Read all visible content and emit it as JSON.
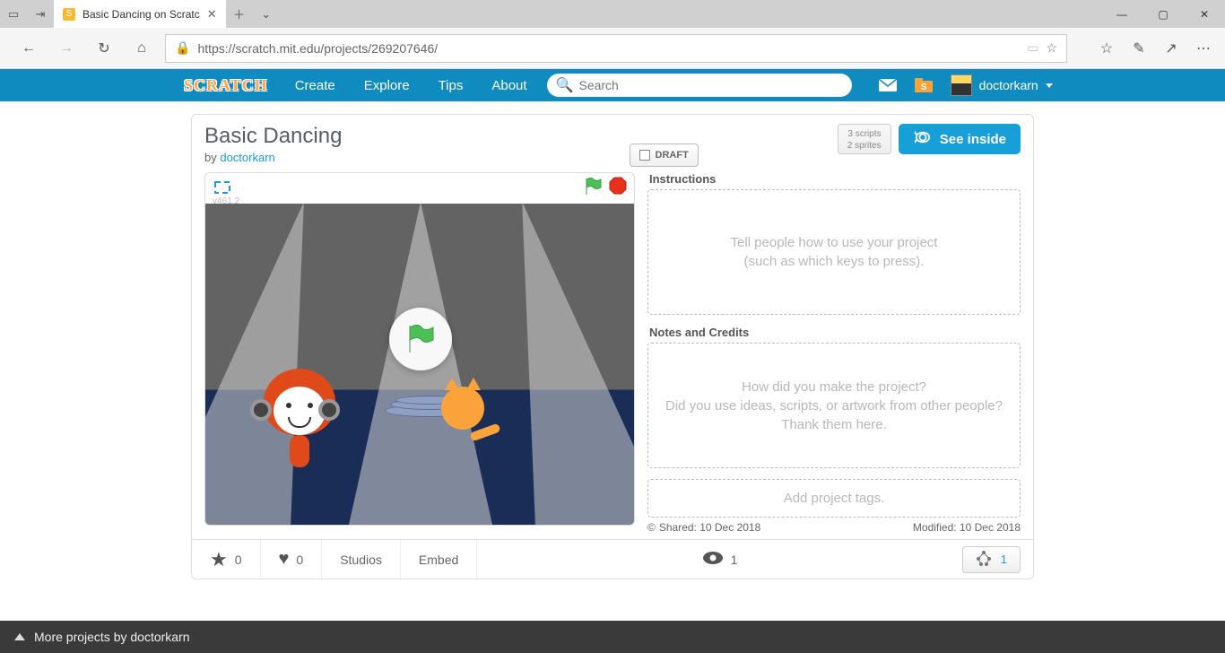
{
  "browser": {
    "tab_title": "Basic Dancing on Scratc",
    "url": "https://scratch.mit.edu/projects/269207646/"
  },
  "nav": {
    "logo": "SCRATCH",
    "links": {
      "create": "Create",
      "explore": "Explore",
      "tips": "Tips",
      "about": "About"
    },
    "search_placeholder": "Search",
    "username": "doctorkarn"
  },
  "project": {
    "title": "Basic Dancing",
    "by_prefix": "by ",
    "author": "doctorkarn",
    "draft_label": "DRAFT",
    "stats": {
      "scripts": "3 scripts",
      "sprites": "2 sprites"
    },
    "see_inside": "See inside",
    "version": "v461.2",
    "instructions_label": "Instructions",
    "instructions_placeholder": "Tell people how to use your project\n(such as which keys to press).",
    "notes_label": "Notes and Credits",
    "notes_placeholder": "How did you make the project?\nDid you use ideas, scripts, or artwork from other people? Thank them here.",
    "tags_placeholder": "Add project tags.",
    "shared": "Shared: 10 Dec 2018",
    "modified": "Modified: 10 Dec 2018",
    "fav_count": "0",
    "love_count": "0",
    "studios": "Studios",
    "embed": "Embed",
    "views": "1",
    "remix": "1"
  },
  "footer": {
    "more": "More projects by doctorkarn"
  }
}
